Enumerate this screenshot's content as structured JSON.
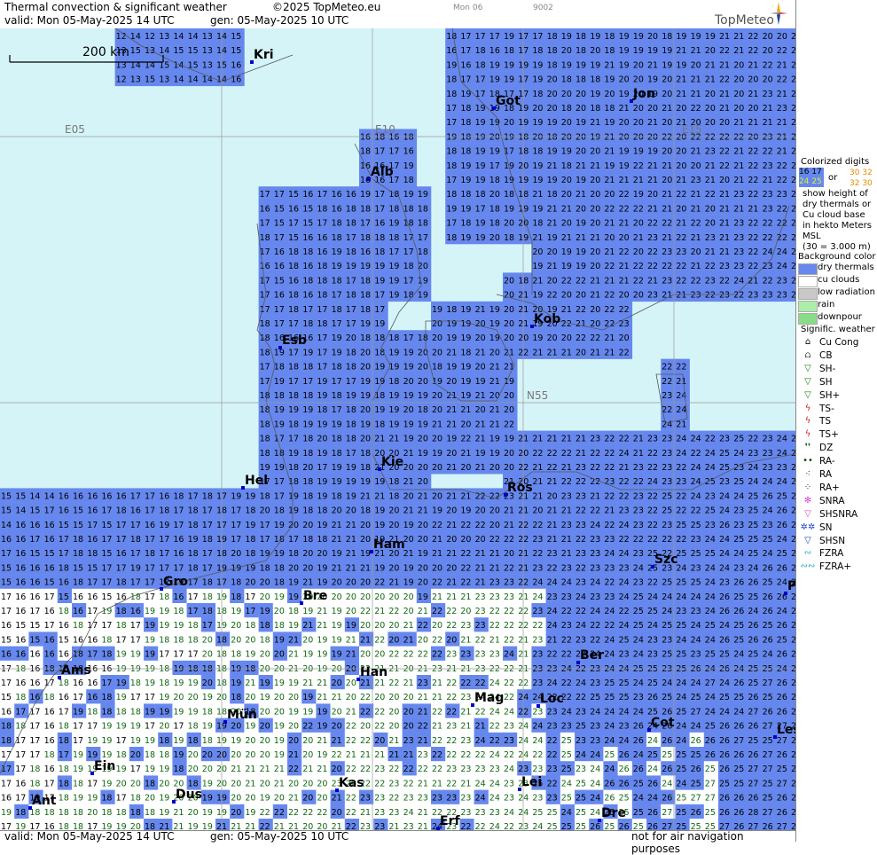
{
  "header": {
    "title": "Thermal convection & significant weather",
    "copyright": "©2025 TopMeteo.eu",
    "valid": "valid:  Mon  05-May-2025  14 UTC",
    "gen": "gen: 05-May-2025 10 UTC",
    "day": "Mon 06",
    "code": "9002",
    "logo": "TopMeteo"
  },
  "footer": {
    "valid": "valid:  Mon  05-May-2025  14 UTC",
    "gen": "gen: 05-May-2025 10 UTC",
    "disclaimer": "not for air navigation purposes"
  },
  "scale_label": "200 km",
  "grid_labels": [
    {
      "text": "E05"
    },
    {
      "text": "E10"
    },
    {
      "text": "E15"
    },
    {
      "text": "N55"
    }
  ],
  "cities": [
    "Kri",
    "Got",
    "Jon",
    "Alb",
    "Kob",
    "Esb",
    "Ros",
    "Kie",
    "Hel",
    "Ham",
    "Szc",
    "Gro",
    "Bre",
    "Ber",
    "Ams",
    "Han",
    "Mag",
    "Loc",
    "Mün",
    "Cot",
    "Les",
    "Ein",
    "Lei",
    "Dus",
    "Kas",
    "Ant",
    "Dre",
    "Erf",
    "P"
  ],
  "legend": {
    "colorized_title": "Colorized digits",
    "sample_a1": "16 17",
    "sample_a2": "24 25",
    "sample_or": "or",
    "sample_b1": "30 32",
    "sample_b2": "32 30",
    "desc": [
      "show height of",
      "dry thermals or",
      "Cu cloud base",
      "in hekto Meters",
      "MSL",
      "(30 = 3.000 m)"
    ],
    "background_title": "Background color",
    "backgrounds": [
      {
        "label": "dry thermals",
        "color": "#6688ee"
      },
      {
        "label": "cu clouds",
        "color": "#ffffff"
      },
      {
        "label": "low radiation",
        "color": "#c8c8c8"
      },
      {
        "label": "rain",
        "color": "#aaeeaa"
      },
      {
        "label": "downpour",
        "color": "#88dd88"
      }
    ],
    "weather_title": "Signific. weather",
    "weather": [
      {
        "label": "Cu Cong",
        "icon": "cu-cong-icon",
        "glyph": "⌂",
        "color": "#000"
      },
      {
        "label": "CB",
        "icon": "cb-icon",
        "glyph": "⩍",
        "color": "#000"
      },
      {
        "label": "SH-",
        "icon": "shower-light-icon",
        "glyph": "▽",
        "color": "#118811"
      },
      {
        "label": "SH",
        "icon": "shower-icon",
        "glyph": "▽",
        "color": "#118811"
      },
      {
        "label": "SH+",
        "icon": "shower-heavy-icon",
        "glyph": "▽",
        "color": "#118811"
      },
      {
        "label": "TS-",
        "icon": "thunderstorm-light-icon",
        "glyph": "ϟ",
        "color": "#cc2222"
      },
      {
        "label": "TS",
        "icon": "thunderstorm-icon",
        "glyph": "ϟ",
        "color": "#cc2222"
      },
      {
        "label": "TS+",
        "icon": "thunderstorm-heavy-icon",
        "glyph": "ϟ",
        "color": "#cc2222"
      },
      {
        "label": "DZ",
        "icon": "drizzle-icon",
        "glyph": "❜❜",
        "color": "#116611"
      },
      {
        "label": "RA-",
        "icon": "rain-light-icon",
        "glyph": "••",
        "color": "#114411"
      },
      {
        "label": "RA",
        "icon": "rain-icon",
        "glyph": "⁖",
        "color": "#114411"
      },
      {
        "label": "RA+",
        "icon": "rain-heavy-icon",
        "glyph": "⁘",
        "color": "#114411"
      },
      {
        "label": "SNRA",
        "icon": "snow-rain-icon",
        "glyph": "✻",
        "color": "#dd44dd"
      },
      {
        "label": "SHSNRA",
        "icon": "snow-rain-shower-icon",
        "glyph": "▽",
        "color": "#dd44dd"
      },
      {
        "label": "SN",
        "icon": "snow-icon",
        "glyph": "✲✲",
        "color": "#2244cc"
      },
      {
        "label": "SHSN",
        "icon": "snow-shower-icon",
        "glyph": "▽",
        "color": "#2244cc"
      },
      {
        "label": "FZRA",
        "icon": "freezing-rain-icon",
        "glyph": "∾",
        "color": "#22aacc"
      },
      {
        "label": "FZRA+",
        "icon": "freezing-rain-heavy-icon",
        "glyph": "∾∾",
        "color": "#22aacc"
      }
    ]
  },
  "colors": {
    "sea": "#d5f4f8",
    "dry": "#6688ee",
    "cu": "#ffffff",
    "low": "#c8c8c8"
  }
}
